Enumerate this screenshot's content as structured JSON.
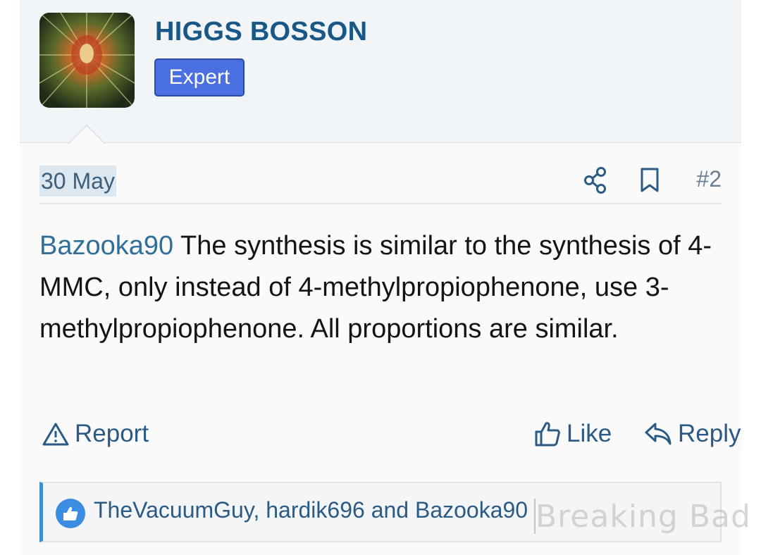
{
  "user": {
    "name": "HIGGS BOSSON",
    "badge": "Expert"
  },
  "post": {
    "date": "30 May",
    "number": "#2",
    "mention": "Bazooka90",
    "body": " The synthesis is similar to the synthesis of 4-MMC, only instead of 4-methylpropiophenone, use 3-methylpropiophenone. All proportions are similar."
  },
  "actions": {
    "report": "Report",
    "like": "Like",
    "reply": "Reply"
  },
  "reactions": {
    "users": "TheVacuumGuy, hardik696 and Bazooka90"
  },
  "watermark": "Breaking Bad",
  "colors": {
    "accent": "#185886",
    "badge": "#4a6fe0",
    "link": "#2f6f9a",
    "like_bubble": "#3a8de0"
  },
  "icons": [
    "share-icon",
    "bookmark-icon",
    "warning-icon",
    "thumbs-up-icon",
    "reply-icon"
  ]
}
